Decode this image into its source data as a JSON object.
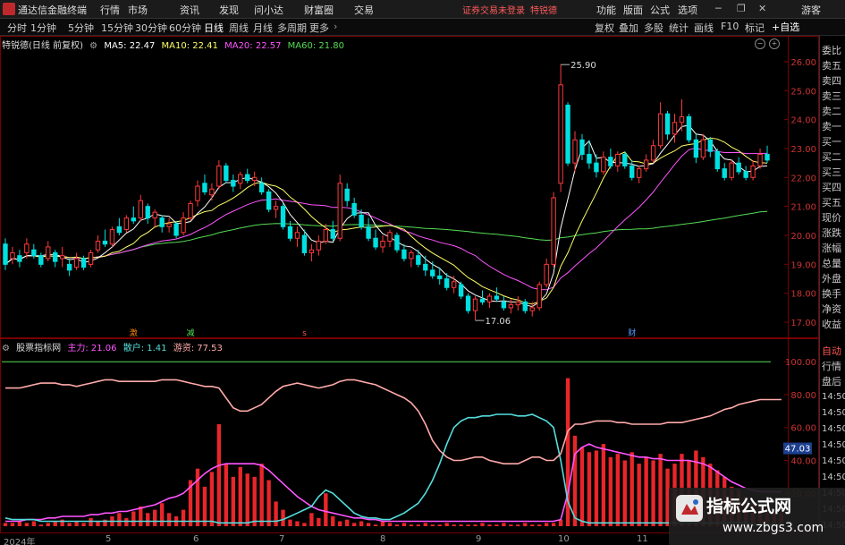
{
  "titlebar": {
    "app_title": "通达信金融终端",
    "menus": [
      "行情",
      "市场",
      "资讯",
      "发现",
      "问小达",
      "财富圈",
      "交易"
    ],
    "login_status": "证券交易未登录",
    "login_stock": "特锐德",
    "right_menus": [
      "功能",
      "版面",
      "公式",
      "选项"
    ],
    "window_controls": [
      "minimize-icon",
      "restore-icon",
      "close-icon"
    ]
  },
  "toolbar": {
    "periods": [
      "分时",
      "1分钟",
      "5分钟",
      "15分钟",
      "30分钟",
      "60分钟",
      "日线",
      "周线",
      "月线",
      "多周期",
      "更多"
    ],
    "active_period": "日线",
    "buttons": [
      "复权",
      "叠加",
      "多股",
      "统计",
      "画线",
      "F10",
      "标记"
    ],
    "autoselect": "+自选",
    "guest": "游客"
  },
  "main_header": {
    "stock": "特锐德(日线 前复权)",
    "ma5_label": "MA5: 22.47",
    "ma10_label": "MA10: 22.41",
    "ma20_label": "MA20: 22.57",
    "ma60_label": "MA60: 21.80"
  },
  "quote_panel": {
    "labels": [
      "委比",
      "卖五",
      "卖四",
      "卖三",
      "卖二",
      "卖一",
      "买一",
      "买二",
      "买三",
      "买四",
      "买五",
      "现价",
      "涨跌",
      "涨幅",
      "总量",
      "外盘",
      "换手",
      "净资",
      "收益"
    ],
    "tabs": [
      "自动",
      "行情",
      "盘后"
    ],
    "times": [
      "14:50",
      "14:50",
      "14:50",
      "14:50",
      "14:50",
      "14:50",
      "14:50",
      "14:50",
      "14:50"
    ]
  },
  "indicator_header": {
    "name": "股票指标网",
    "main_label": "主力: 21.06",
    "retail_label": "散户: 1.41",
    "hot_label": "游资: 77.53"
  },
  "annotations": {
    "high": "25.90",
    "low": "17.06",
    "markers": [
      "激",
      "减",
      "s",
      "财"
    ],
    "current_value": "47.03"
  },
  "watermark": {
    "title": "指标公式网",
    "url": "www.zbgs3.com"
  },
  "chart_data": [
    {
      "type": "candlestick",
      "title": "特锐德(日线 前复权)",
      "y_axis_ticks": [
        17.0,
        18.0,
        19.0,
        20.0,
        21.0,
        22.0,
        23.0,
        24.0,
        25.0,
        26.0
      ],
      "ylim": [
        16.6,
        26.4
      ],
      "up_color": "#ff3a3a",
      "down_color": "#00e0e0",
      "ohlc": [
        [
          19.7,
          19.9,
          18.8,
          19.0
        ],
        [
          19.2,
          19.6,
          19.0,
          19.4
        ],
        [
          19.3,
          19.5,
          18.9,
          19.1
        ],
        [
          19.4,
          19.9,
          19.2,
          19.7
        ],
        [
          19.5,
          19.7,
          19.2,
          19.3
        ],
        [
          19.3,
          19.4,
          18.9,
          19.0
        ],
        [
          19.2,
          19.8,
          19.1,
          19.6
        ],
        [
          19.4,
          19.5,
          18.9,
          19.1
        ],
        [
          19.2,
          19.6,
          18.9,
          19.3
        ],
        [
          19.0,
          19.2,
          18.6,
          18.8
        ],
        [
          18.9,
          19.4,
          18.8,
          19.2
        ],
        [
          19.2,
          19.3,
          18.8,
          18.9
        ],
        [
          19.0,
          19.5,
          18.9,
          19.4
        ],
        [
          19.5,
          20.0,
          19.4,
          19.8
        ],
        [
          19.8,
          20.2,
          19.6,
          19.7
        ],
        [
          19.7,
          20.3,
          19.6,
          20.2
        ],
        [
          20.3,
          20.6,
          20.0,
          20.1
        ],
        [
          20.2,
          20.7,
          20.1,
          20.6
        ],
        [
          20.6,
          21.0,
          20.4,
          20.5
        ],
        [
          20.6,
          21.4,
          20.5,
          21.2
        ],
        [
          21.0,
          21.1,
          20.4,
          20.6
        ],
        [
          20.6,
          20.9,
          20.3,
          20.8
        ],
        [
          20.6,
          20.7,
          20.1,
          20.3
        ],
        [
          20.3,
          20.6,
          20.1,
          20.4
        ],
        [
          20.4,
          20.5,
          19.9,
          20.0
        ],
        [
          20.1,
          20.8,
          20.0,
          20.6
        ],
        [
          20.6,
          21.2,
          20.5,
          21.1
        ],
        [
          21.2,
          21.9,
          21.0,
          21.7
        ],
        [
          21.8,
          22.1,
          21.4,
          21.5
        ],
        [
          21.4,
          21.8,
          21.2,
          21.6
        ],
        [
          21.7,
          22.6,
          21.6,
          22.4
        ],
        [
          22.4,
          22.5,
          21.8,
          21.9
        ],
        [
          21.9,
          22.1,
          21.5,
          21.7
        ],
        [
          21.8,
          22.2,
          21.6,
          22.1
        ],
        [
          22.1,
          22.3,
          21.8,
          21.9
        ],
        [
          21.9,
          22.2,
          21.7,
          22.0
        ],
        [
          21.8,
          22.0,
          21.4,
          21.5
        ],
        [
          21.5,
          21.6,
          20.8,
          20.9
        ],
        [
          20.9,
          21.2,
          20.6,
          21.0
        ],
        [
          21.0,
          21.1,
          20.2,
          20.3
        ],
        [
          20.3,
          20.5,
          19.8,
          19.9
        ],
        [
          19.9,
          20.3,
          19.6,
          20.1
        ],
        [
          20.0,
          20.2,
          19.3,
          19.4
        ],
        [
          19.4,
          19.7,
          19.1,
          19.5
        ],
        [
          19.5,
          20.0,
          19.3,
          19.8
        ],
        [
          19.8,
          20.4,
          19.7,
          20.2
        ],
        [
          20.2,
          20.5,
          19.8,
          19.9
        ],
        [
          19.9,
          22.1,
          19.8,
          21.8
        ],
        [
          21.6,
          21.8,
          21.0,
          21.2
        ],
        [
          21.1,
          21.3,
          20.6,
          20.7
        ],
        [
          20.7,
          20.9,
          20.2,
          20.3
        ],
        [
          20.3,
          20.6,
          19.8,
          19.9
        ],
        [
          19.9,
          20.2,
          19.5,
          19.6
        ],
        [
          19.6,
          20.0,
          19.4,
          19.8
        ],
        [
          19.8,
          20.2,
          19.6,
          20.1
        ],
        [
          20.0,
          20.1,
          19.4,
          19.5
        ],
        [
          19.5,
          19.7,
          19.1,
          19.2
        ],
        [
          19.2,
          19.5,
          18.9,
          19.4
        ],
        [
          19.3,
          19.5,
          18.9,
          19.0
        ],
        [
          19.0,
          19.3,
          18.6,
          18.8
        ],
        [
          18.8,
          19.1,
          18.5,
          18.6
        ],
        [
          18.6,
          18.9,
          18.3,
          18.5
        ],
        [
          18.5,
          18.7,
          18.1,
          18.2
        ],
        [
          18.2,
          18.6,
          18.0,
          18.4
        ],
        [
          18.3,
          18.4,
          17.8,
          17.9
        ],
        [
          17.9,
          18.0,
          17.3,
          17.4
        ],
        [
          17.4,
          17.9,
          17.06,
          17.8
        ],
        [
          17.8,
          18.1,
          17.6,
          17.7
        ],
        [
          17.7,
          18.0,
          17.5,
          17.9
        ],
        [
          17.9,
          18.2,
          17.7,
          17.8
        ],
        [
          17.7,
          17.9,
          17.4,
          17.5
        ],
        [
          17.5,
          17.8,
          17.3,
          17.6
        ],
        [
          17.6,
          17.9,
          17.4,
          17.7
        ],
        [
          17.7,
          17.8,
          17.3,
          17.4
        ],
        [
          17.4,
          17.7,
          17.2,
          17.5
        ],
        [
          17.5,
          18.4,
          17.4,
          18.3
        ],
        [
          18.3,
          19.2,
          18.2,
          19.0
        ],
        [
          19.0,
          21.5,
          18.9,
          21.3
        ],
        [
          21.8,
          25.9,
          21.5,
          25.2
        ],
        [
          24.5,
          24.6,
          22.4,
          22.5
        ],
        [
          22.5,
          23.6,
          22.2,
          23.3
        ],
        [
          23.3,
          23.5,
          22.6,
          22.8
        ],
        [
          22.8,
          23.3,
          22.3,
          22.5
        ],
        [
          22.5,
          22.8,
          22.0,
          22.2
        ],
        [
          22.2,
          22.9,
          22.1,
          22.7
        ],
        [
          22.7,
          23.0,
          22.3,
          22.4
        ],
        [
          22.4,
          22.9,
          22.2,
          22.8
        ],
        [
          22.8,
          22.9,
          22.3,
          22.4
        ],
        [
          22.4,
          22.6,
          21.9,
          22.0
        ],
        [
          22.0,
          22.4,
          21.8,
          22.3
        ],
        [
          22.3,
          22.8,
          22.2,
          22.6
        ],
        [
          22.6,
          23.3,
          22.5,
          23.1
        ],
        [
          23.1,
          24.6,
          23.0,
          24.2
        ],
        [
          24.2,
          24.3,
          23.3,
          23.5
        ],
        [
          23.5,
          24.2,
          23.2,
          23.9
        ],
        [
          23.9,
          24.7,
          23.6,
          24.1
        ],
        [
          24.1,
          24.2,
          23.2,
          23.3
        ],
        [
          23.3,
          23.5,
          22.5,
          22.7
        ],
        [
          22.7,
          23.5,
          22.6,
          23.3
        ],
        [
          23.3,
          23.4,
          22.7,
          22.9
        ],
        [
          22.9,
          23.0,
          22.2,
          22.3
        ],
        [
          22.3,
          22.5,
          21.9,
          22.0
        ],
        [
          22.0,
          22.6,
          21.9,
          22.5
        ],
        [
          22.5,
          22.7,
          22.1,
          22.2
        ],
        [
          22.2,
          22.4,
          21.9,
          22.0
        ],
        [
          22.0,
          22.6,
          21.9,
          22.4
        ],
        [
          22.4,
          23.0,
          22.3,
          22.8
        ],
        [
          22.8,
          23.1,
          22.5,
          22.6
        ]
      ],
      "ma_colors": {
        "ma5": "#ffffff",
        "ma10": "#ffff66",
        "ma20": "#ff55ff",
        "ma60": "#55dd55"
      }
    },
    {
      "type": "bar+line",
      "title": "股票指标网",
      "y_axis_ticks": [
        20.0,
        40.0,
        60.0,
        80.0,
        100.0
      ],
      "ylim": [
        0,
        105
      ],
      "reference_line": 100,
      "bars": [
        2,
        2,
        3,
        2,
        3,
        1,
        2,
        3,
        4,
        2,
        3,
        2,
        5,
        3,
        4,
        6,
        8,
        5,
        9,
        12,
        8,
        10,
        14,
        8,
        6,
        10,
        28,
        35,
        24,
        33,
        62,
        38,
        30,
        36,
        32,
        30,
        38,
        28,
        15,
        10,
        4,
        3,
        2,
        8,
        5,
        20,
        6,
        3,
        4,
        2,
        3,
        2,
        1,
        3,
        2,
        1,
        2,
        1,
        1,
        2,
        1,
        1,
        2,
        1,
        1,
        1,
        1,
        2,
        1,
        1,
        2,
        1,
        1,
        2,
        1,
        1,
        2,
        2,
        4,
        90,
        55,
        48,
        45,
        46,
        50,
        42,
        44,
        40,
        45,
        38,
        42,
        40,
        44,
        35,
        38,
        44,
        40,
        46,
        42,
        38,
        34,
        30,
        24,
        22,
        18,
        14,
        12,
        10,
        9,
        8
      ],
      "series": [
        {
          "name": "主力",
          "color": "#ff55ff",
          "values": [
            3,
            3,
            3,
            4,
            4,
            4,
            5,
            5,
            6,
            6,
            6,
            6,
            7,
            7,
            8,
            8,
            9,
            9,
            10,
            11,
            12,
            13,
            15,
            17,
            18,
            20,
            24,
            28,
            32,
            35,
            37,
            38,
            38,
            38,
            38,
            38,
            37,
            34,
            30,
            26,
            22,
            18,
            15,
            12,
            10,
            9,
            8,
            7,
            6,
            5,
            5,
            4,
            4,
            3,
            3,
            3,
            3,
            3,
            3,
            3,
            3,
            3,
            3,
            3,
            3,
            3,
            3,
            3,
            3,
            3,
            3,
            3,
            3,
            3,
            3,
            3,
            3,
            3,
            4,
            20,
            44,
            48,
            50,
            48,
            47,
            46,
            45,
            44,
            43,
            42,
            42,
            41,
            41,
            40,
            40,
            40,
            40,
            39,
            38,
            36,
            33,
            30,
            27,
            25,
            23,
            22,
            21,
            21,
            21,
            21
          ]
        },
        {
          "name": "散户",
          "color": "#55dddd",
          "values": [
            5,
            4,
            4,
            4,
            4,
            3,
            3,
            3,
            3,
            3,
            3,
            3,
            3,
            3,
            3,
            3,
            3,
            3,
            3,
            3,
            3,
            3,
            3,
            3,
            3,
            3,
            3,
            3,
            3,
            3,
            2,
            2,
            2,
            2,
            2,
            3,
            3,
            3,
            3,
            4,
            6,
            8,
            10,
            12,
            18,
            22,
            20,
            16,
            12,
            8,
            6,
            5,
            5,
            4,
            4,
            6,
            8,
            11,
            14,
            20,
            28,
            38,
            50,
            60,
            64,
            66,
            66,
            67,
            67,
            68,
            68,
            68,
            67,
            67,
            68,
            66,
            64,
            60,
            40,
            15,
            5,
            3,
            2,
            2,
            2,
            2,
            2,
            2,
            2,
            2,
            2,
            2,
            2,
            2,
            2,
            2,
            2,
            2,
            2,
            2,
            2,
            2,
            2,
            2,
            2,
            1,
            1,
            1,
            1,
            1
          ]
        },
        {
          "name": "游资",
          "color": "#ffaaaa",
          "values": [
            84,
            84,
            84,
            85,
            86,
            87,
            87,
            87,
            86,
            86,
            85,
            86,
            87,
            88,
            89,
            89,
            88,
            88,
            88,
            88,
            88,
            88,
            89,
            89,
            89,
            88,
            87,
            86,
            85,
            85,
            84,
            78,
            72,
            70,
            70,
            72,
            74,
            78,
            82,
            85,
            86,
            87,
            86,
            85,
            84,
            85,
            86,
            88,
            89,
            89,
            88,
            87,
            86,
            84,
            82,
            80,
            78,
            75,
            70,
            62,
            52,
            46,
            42,
            40,
            40,
            41,
            42,
            42,
            40,
            39,
            38,
            38,
            38,
            40,
            42,
            42,
            40,
            40,
            44,
            58,
            62,
            62,
            63,
            64,
            64,
            64,
            63,
            63,
            62,
            62,
            62,
            62,
            62,
            63,
            63,
            63,
            64,
            65,
            66,
            67,
            69,
            71,
            72,
            74,
            75,
            76,
            77,
            77,
            77,
            77
          ]
        }
      ]
    }
  ],
  "x_axis_labels": [
    "2024年",
    "5",
    "6",
    "7",
    "8",
    "9",
    "10",
    "11"
  ]
}
